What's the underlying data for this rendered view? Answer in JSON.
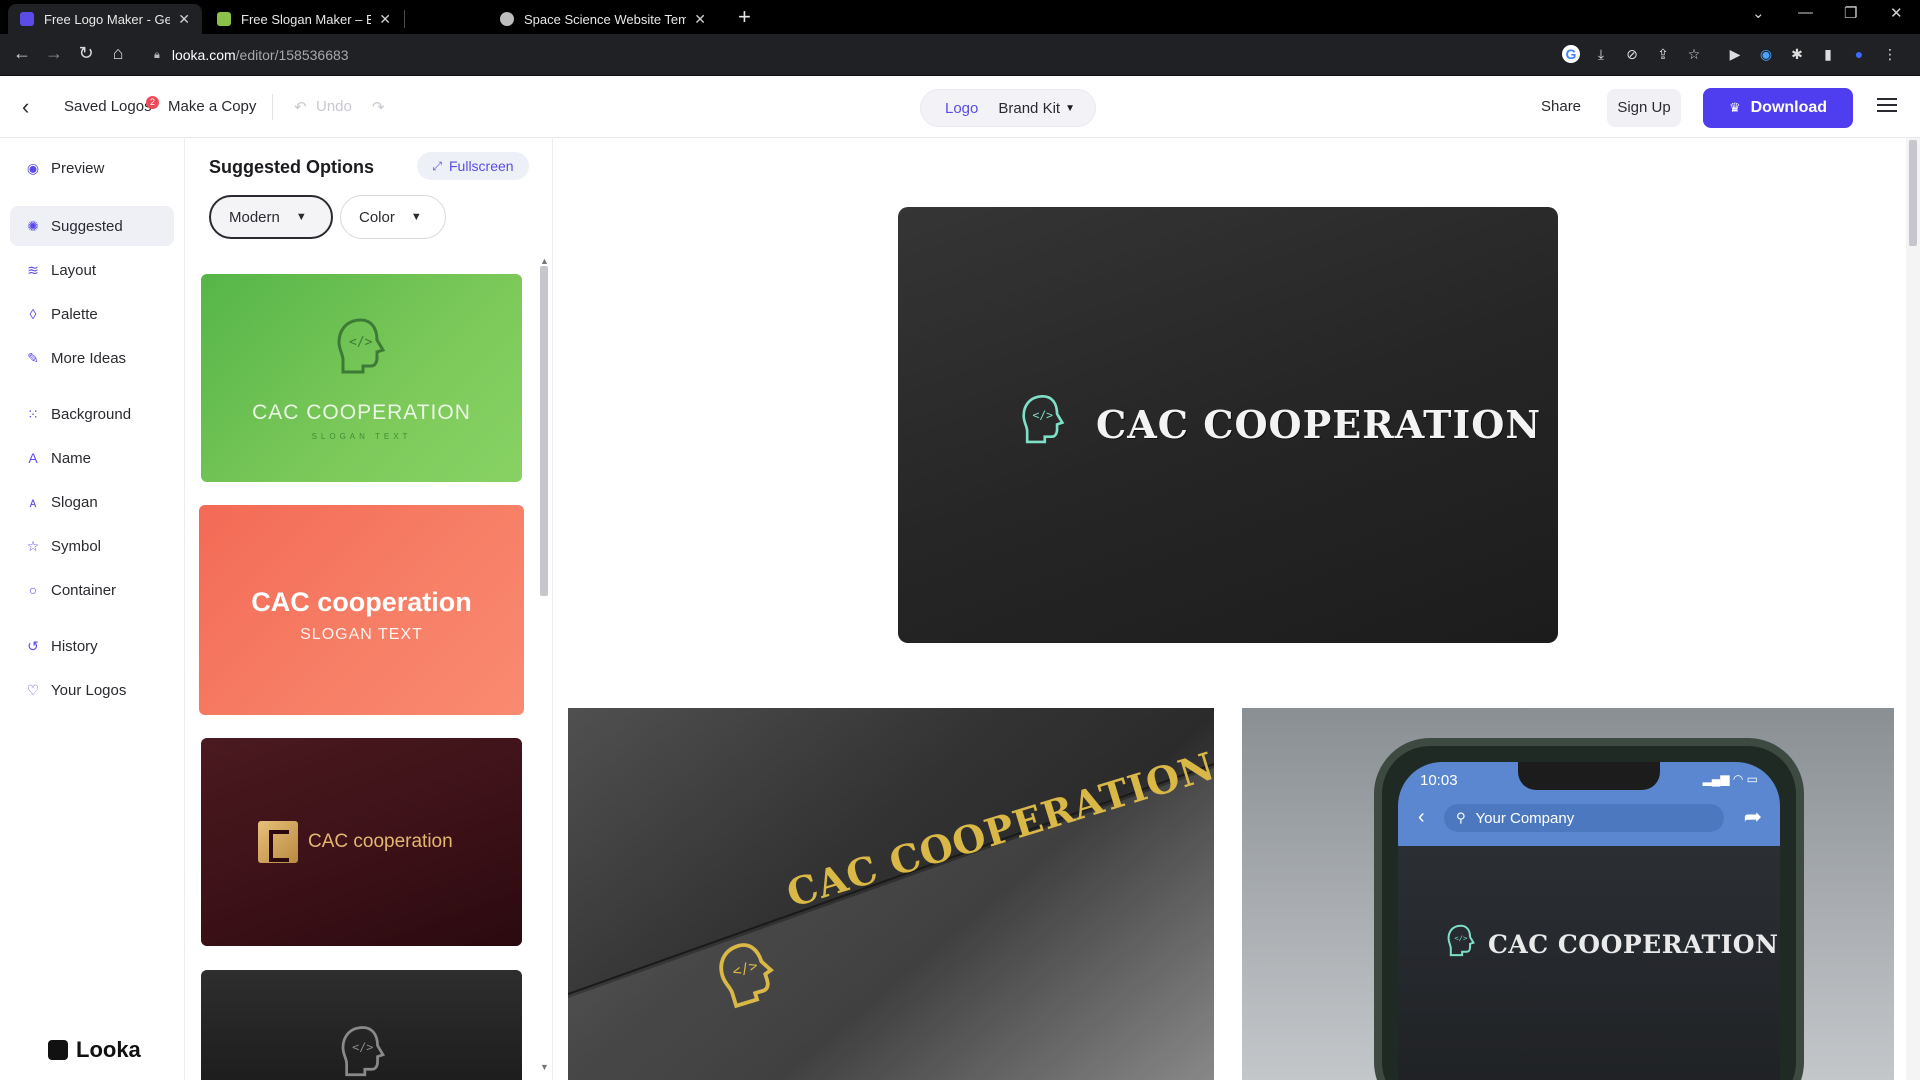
{
  "browser": {
    "tabs": [
      {
        "title": "Free Logo Maker - Get Custom L",
        "favicon_color": "#5b4ce8",
        "active": true
      },
      {
        "title": "Free Slogan Maker – Business Sl",
        "favicon_color": "#8bc34a",
        "active": false
      },
      {
        "title": "Space Science Website Template",
        "favicon_color": "#bdbdbd",
        "active": false
      }
    ],
    "new_tab": "+",
    "url_domain": "looka.com",
    "url_path": "/editor/158536683"
  },
  "header": {
    "saved_logos": "Saved Logos",
    "saved_badge": "2",
    "make_copy": "Make a Copy",
    "undo": "Undo",
    "seg_logo": "Logo",
    "seg_brand_kit": "Brand Kit",
    "share": "Share",
    "sign_up": "Sign Up",
    "download": "Download"
  },
  "sidebar": {
    "items": [
      {
        "label": "Preview",
        "icon": "eye-icon",
        "glyph": "◉"
      },
      {
        "label": "Suggested",
        "icon": "bulb-icon",
        "glyph": "✺",
        "active": true
      },
      {
        "label": "Layout",
        "icon": "layers-icon",
        "glyph": "≋"
      },
      {
        "label": "Palette",
        "icon": "drop-icon",
        "glyph": "◊"
      },
      {
        "label": "More Ideas",
        "icon": "wand-icon",
        "glyph": "✎"
      },
      {
        "label": "Background",
        "icon": "grid-icon",
        "glyph": "⁙"
      },
      {
        "label": "Name",
        "icon": "text-icon",
        "glyph": "A"
      },
      {
        "label": "Slogan",
        "icon": "slogan-icon",
        "glyph": "ᴀ"
      },
      {
        "label": "Symbol",
        "icon": "star-icon",
        "glyph": "☆"
      },
      {
        "label": "Container",
        "icon": "circle-icon",
        "glyph": "○"
      },
      {
        "label": "History",
        "icon": "history-icon",
        "glyph": "↺"
      },
      {
        "label": "Your Logos",
        "icon": "heart-icon",
        "glyph": "♡"
      }
    ],
    "brand": "Looka"
  },
  "options": {
    "title": "Suggested Options",
    "fullscreen": "Fullscreen",
    "style_filter": "Modern",
    "color_filter": "Color",
    "cards": [
      {
        "name": "CAC COOPERATION",
        "slogan": "SLOGAN TEXT",
        "bg": "#6cc04f"
      },
      {
        "name": "CAC cooperation",
        "slogan": "SLOGAN TEXT",
        "bg": "#f5765f"
      },
      {
        "name": "CAC cooperation",
        "slogan": "",
        "bg": "#3a1016"
      },
      {
        "name": "",
        "slogan": "",
        "bg": "#262626"
      }
    ]
  },
  "preview": {
    "hero_name": "CAC COOPERATION",
    "card_mock_name": "CAC COOPERATION",
    "phone": {
      "time": "10:03",
      "search_text": "Your Company",
      "name": "CAC COOPERATION"
    },
    "icon_color": "#7fe0c8",
    "gold_color": "#d9b848"
  }
}
